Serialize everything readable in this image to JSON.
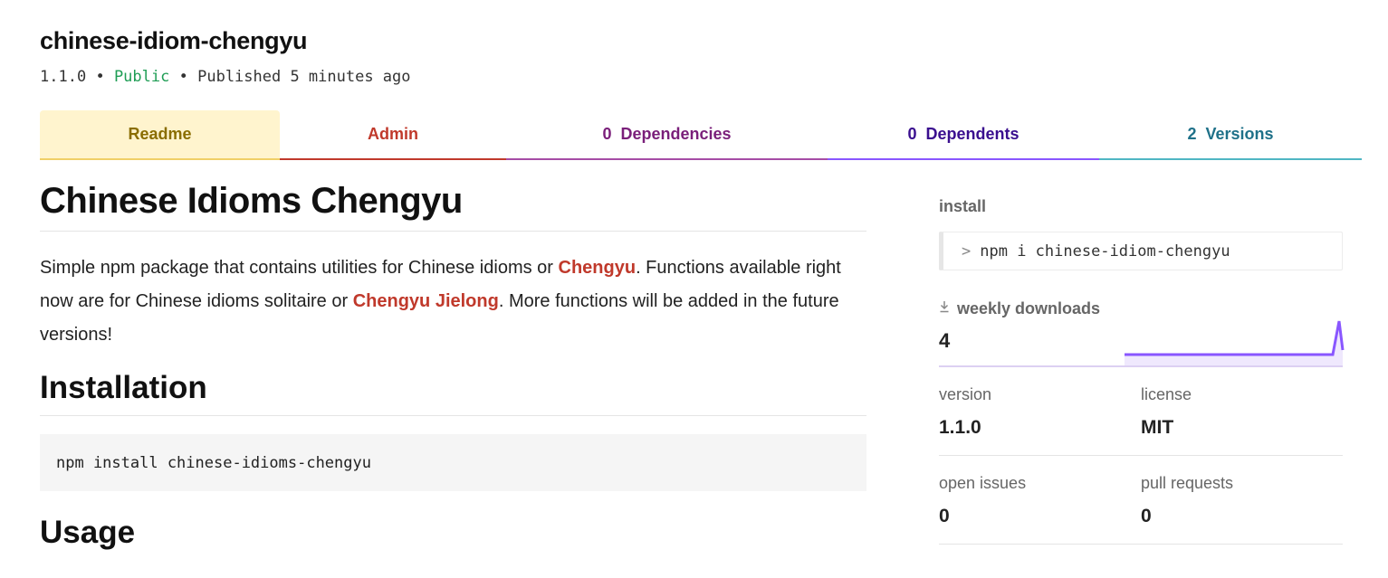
{
  "package": {
    "name": "chinese-idiom-chengyu",
    "version": "1.1.0",
    "sep1": "•",
    "visibility": "Public",
    "sep2": "•",
    "published": "Published 5 minutes ago"
  },
  "tabs": {
    "readme": "Readme",
    "admin": "Admin",
    "dependencies_count": "0",
    "dependencies": "Dependencies",
    "dependents_count": "0",
    "dependents": "Dependents",
    "versions_count": "2",
    "versions": "Versions"
  },
  "readme": {
    "title": "Chinese Idioms Chengyu",
    "intro_1": "Simple npm package that contains utilities for Chinese idioms or ",
    "link_1": "Chengyu",
    "intro_2": ". Functions available right now are for Chinese idioms solitaire or ",
    "link_2": "Chengyu Jielong",
    "intro_3": ". More functions will be added in the future versions!",
    "installation_heading": "Installation",
    "install_code": "npm install chinese-idioms-chengyu",
    "usage_heading": "Usage"
  },
  "sidebar": {
    "install_label": "install",
    "install_prompt": ">",
    "install_cmd": "npm i chinese-idiom-chengyu",
    "downloads_label": "weekly downloads",
    "downloads_value": "4",
    "version_label": "version",
    "version_value": "1.1.0",
    "license_label": "license",
    "license_value": "MIT",
    "issues_label": "open issues",
    "issues_value": "0",
    "prs_label": "pull requests",
    "prs_value": "0"
  },
  "colors": {
    "accent_public": "#1f9d55",
    "link": "#c0392b",
    "sparkline": "#8956ff"
  },
  "icons": {
    "download": "download-icon",
    "chevron": "chevron-right-icon"
  }
}
